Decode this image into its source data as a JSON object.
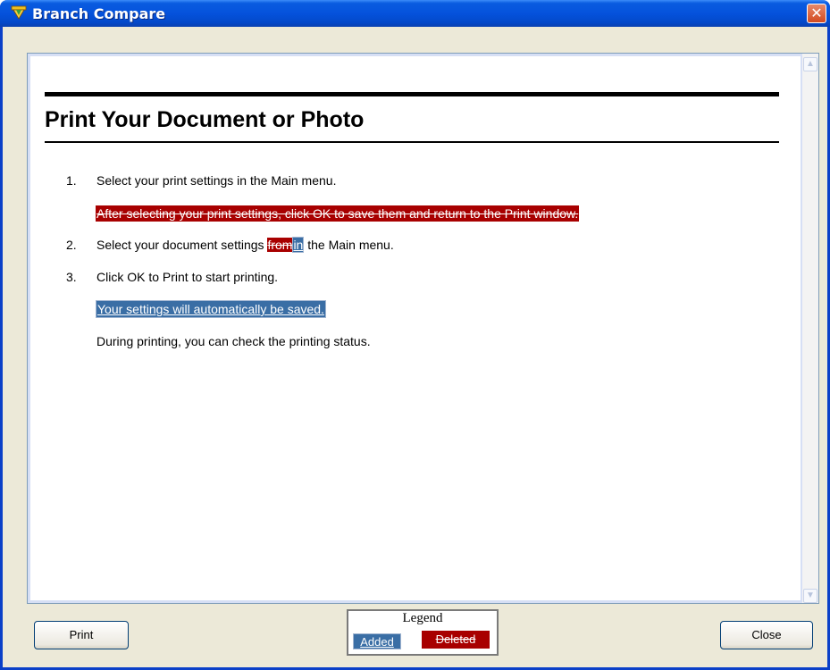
{
  "window": {
    "title": "Branch Compare",
    "close_glyph": "✕"
  },
  "document": {
    "heading": "Print Your Document or Photo",
    "items": [
      {
        "number": "1.",
        "text": "Select your print settings in the Main menu."
      },
      {
        "deleted_text": "After selecting your print settings, click OK to save them and return to the Print window."
      },
      {
        "number": "2.",
        "text_before": "Select your document settings ",
        "deleted_word": "from",
        "added_word": "in",
        "text_after": " the Main menu."
      },
      {
        "number": "3.",
        "text": "Click OK to Print to start printing."
      },
      {
        "added_text": "Your settings will automatically be saved."
      },
      {
        "text": "During printing, you can check the printing status."
      }
    ]
  },
  "buttons": {
    "print_label": "Print",
    "close_label": "Close"
  },
  "legend": {
    "title": "Legend",
    "added_label": "Added",
    "deleted_label": "Deleted"
  },
  "icons": {
    "scroll_up": "scroll-up-arrow-icon",
    "scroll_down": "scroll-down-arrow-icon",
    "app": "branch-compare-app-icon"
  },
  "colors": {
    "added_bg": "#3a6ea5",
    "deleted_bg": "#a80000",
    "title_bar": "#0552dc"
  }
}
